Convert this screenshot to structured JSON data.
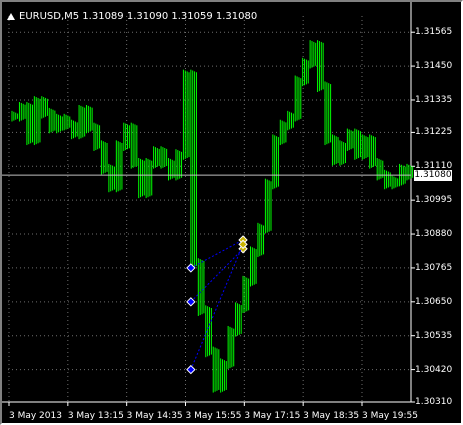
{
  "window": {
    "title": "EURUSD,M5  1.31089 1.31090 1.31059 1.31080"
  },
  "price_axis": {
    "labels": [
      "1.31565",
      "1.31450",
      "1.31335",
      "1.31225",
      "1.31110",
      "1.31080",
      "1.30995",
      "1.30880",
      "1.30765",
      "1.30650",
      "1.30535",
      "1.30420",
      "1.30310"
    ],
    "current_price": "1.31080"
  },
  "time_axis": {
    "labels": [
      "3 May 2013",
      "3 May 13:15",
      "3 May 14:35",
      "3 May 15:55",
      "3 May 17:15",
      "3 May 18:35",
      "3 May 19:55"
    ]
  },
  "colors": {
    "background": "#000000",
    "candle": "#00ff00",
    "grid": "#6e6e6e",
    "trade_line": "#0000ff",
    "entry_marker": "#0000ff",
    "exit_marker": "#c8b400",
    "current_price_line": "#c0c0c0"
  },
  "chart_data": {
    "type": "line",
    "symbol": "EURUSD",
    "timeframe": "M5",
    "ohlc_header": {
      "open": 1.31089,
      "high": 1.3109,
      "low": 1.31059,
      "close": 1.3108
    },
    "ylim": [
      1.3031,
      1.3162
    ],
    "x": [
      "3 May 2013",
      "3 May 13:15",
      "3 May 14:35",
      "3 May 15:55",
      "3 May 17:15",
      "3 May 18:35",
      "3 May 19:55"
    ],
    "grid": true,
    "series": [
      {
        "values": [
          1.3128,
          1.3131,
          1.312,
          1.3133,
          1.3129,
          1.3124,
          1.3127,
          1.3125,
          1.3122,
          1.313,
          1.3124,
          1.3118,
          1.311,
          1.3104,
          1.3118,
          1.3124,
          1.3112,
          1.3102,
          1.3112,
          1.3116,
          1.3112,
          1.3108,
          1.3115,
          1.3142,
          1.3078,
          1.3062,
          1.3048,
          1.3036,
          1.3044,
          1.3055,
          1.3063,
          1.3072,
          1.3082,
          1.309,
          1.3105,
          1.312,
          1.3125,
          1.3128,
          1.314,
          1.3146,
          1.3152,
          1.3138,
          1.312,
          1.3113,
          1.3118,
          1.3122,
          1.3115,
          1.312,
          1.3112,
          1.3108,
          1.3105,
          1.3106,
          1.311,
          1.3108
        ]
      }
    ],
    "trades": [
      {
        "entry": 1.30765,
        "exit": 1.3086
      },
      {
        "entry": 1.3065,
        "exit": 1.3083
      },
      {
        "entry": 1.3042,
        "exit": 1.30845
      }
    ]
  }
}
